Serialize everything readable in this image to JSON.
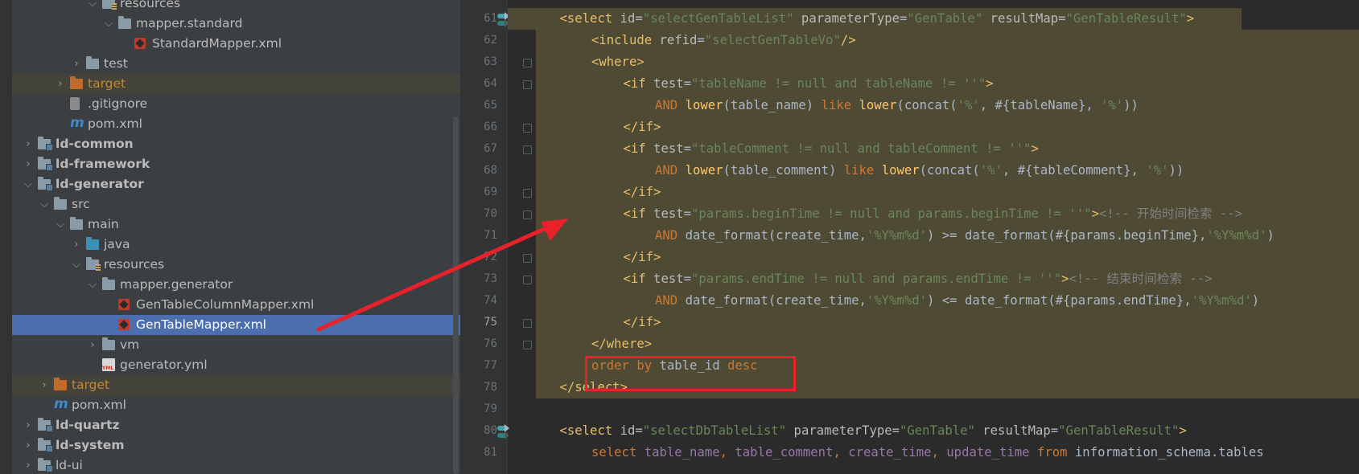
{
  "project_tree": {
    "rows": [
      {
        "label": "resources",
        "depth": 5,
        "icon": "resources-folder-icon",
        "expanded": true
      },
      {
        "label": "mapper.standard",
        "depth": 6,
        "icon": "folder-icon",
        "expanded": true
      },
      {
        "label": "StandardMapper.xml",
        "depth": 7,
        "icon": "xml-file-icon"
      },
      {
        "label": "test",
        "depth": 4,
        "icon": "folder-icon",
        "expanded": false
      },
      {
        "label": "target",
        "depth": 3,
        "icon": "excluded-folder-icon",
        "expanded": false,
        "style": "excluded"
      },
      {
        "label": ".gitignore",
        "depth": 3,
        "icon": "gitignore-file-icon"
      },
      {
        "label": "pom.xml",
        "depth": 3,
        "icon": "maven-file-icon"
      },
      {
        "label": "ld-common",
        "depth": 1,
        "icon": "module-folder-icon",
        "expanded": false,
        "bold": true
      },
      {
        "label": "ld-framework",
        "depth": 1,
        "icon": "module-folder-icon",
        "expanded": false,
        "bold": true
      },
      {
        "label": "ld-generator",
        "depth": 1,
        "icon": "module-folder-icon",
        "expanded": true,
        "bold": true
      },
      {
        "label": "src",
        "depth": 2,
        "icon": "folder-icon",
        "expanded": true
      },
      {
        "label": "main",
        "depth": 3,
        "icon": "folder-icon",
        "expanded": true
      },
      {
        "label": "java",
        "depth": 4,
        "icon": "source-folder-icon",
        "expanded": false
      },
      {
        "label": "resources",
        "depth": 4,
        "icon": "resources-folder-icon",
        "expanded": true
      },
      {
        "label": "mapper.generator",
        "depth": 5,
        "icon": "folder-icon",
        "expanded": true
      },
      {
        "label": "GenTableColumnMapper.xml",
        "depth": 6,
        "icon": "xml-file-icon"
      },
      {
        "label": "GenTableMapper.xml",
        "depth": 6,
        "icon": "xml-file-icon",
        "selected": true
      },
      {
        "label": "vm",
        "depth": 5,
        "icon": "folder-icon",
        "expanded": false
      },
      {
        "label": "generator.yml",
        "depth": 5,
        "icon": "yml-file-icon"
      },
      {
        "label": "target",
        "depth": 2,
        "icon": "excluded-folder-icon",
        "expanded": false,
        "style": "excluded"
      },
      {
        "label": "pom.xml",
        "depth": 2,
        "icon": "maven-file-icon"
      },
      {
        "label": "ld-quartz",
        "depth": 1,
        "icon": "module-folder-icon",
        "expanded": false,
        "bold": true
      },
      {
        "label": "ld-system",
        "depth": 1,
        "icon": "module-folder-icon",
        "expanded": false,
        "bold": true
      },
      {
        "label": "ld-ui",
        "depth": 1,
        "icon": "module-folder-icon",
        "expanded": false
      }
    ]
  },
  "editor": {
    "current_line": "75",
    "lines": [
      {
        "no": "61",
        "tokens": [
          {
            "t": "<select ",
            "c": "tag"
          },
          {
            "t": "id",
            "c": "attr"
          },
          {
            "t": "=",
            "c": "id"
          },
          {
            "t": "\"selectGenTableList\"",
            "c": "str"
          },
          {
            "t": " parameterType",
            "c": "attr"
          },
          {
            "t": "=",
            "c": "id"
          },
          {
            "t": "\"GenTable\"",
            "c": "str"
          },
          {
            "t": " resultMap",
            "c": "attr"
          },
          {
            "t": "=",
            "c": "id"
          },
          {
            "t": "\"GenTableResult\"",
            "c": "str"
          },
          {
            "t": ">",
            "c": "tag"
          }
        ]
      },
      {
        "no": "62",
        "tokens": [
          {
            "t": "<include ",
            "c": "tag"
          },
          {
            "t": "refid",
            "c": "attr"
          },
          {
            "t": "=",
            "c": "id"
          },
          {
            "t": "\"selectGenTableVo\"",
            "c": "str"
          },
          {
            "t": "/>",
            "c": "tag"
          }
        ]
      },
      {
        "no": "63",
        "tokens": [
          {
            "t": "<where>",
            "c": "tag"
          }
        ]
      },
      {
        "no": "64",
        "tokens": [
          {
            "t": "<if ",
            "c": "tag"
          },
          {
            "t": "test",
            "c": "attr"
          },
          {
            "t": "=",
            "c": "id"
          },
          {
            "t": "\"tableName != null and tableName != ''\"",
            "c": "str"
          },
          {
            "t": ">",
            "c": "tag"
          }
        ]
      },
      {
        "no": "65",
        "tokens": [
          {
            "t": "AND ",
            "c": "kw"
          },
          {
            "t": "lower",
            "c": "fn"
          },
          {
            "t": "(table_name) ",
            "c": "id"
          },
          {
            "t": "like ",
            "c": "kw"
          },
          {
            "t": "lower",
            "c": "fn"
          },
          {
            "t": "(concat(",
            "c": "id"
          },
          {
            "t": "'%'",
            "c": "str"
          },
          {
            "t": ", #{tableName}, ",
            "c": "id"
          },
          {
            "t": "'%'",
            "c": "str"
          },
          {
            "t": "))",
            "c": "id"
          }
        ]
      },
      {
        "no": "66",
        "tokens": [
          {
            "t": "</if>",
            "c": "tag"
          }
        ]
      },
      {
        "no": "67",
        "tokens": [
          {
            "t": "<if ",
            "c": "tag"
          },
          {
            "t": "test",
            "c": "attr"
          },
          {
            "t": "=",
            "c": "id"
          },
          {
            "t": "\"tableComment != null and tableComment != ''\"",
            "c": "str"
          },
          {
            "t": ">",
            "c": "tag"
          }
        ]
      },
      {
        "no": "68",
        "tokens": [
          {
            "t": "AND ",
            "c": "kw"
          },
          {
            "t": "lower",
            "c": "fn"
          },
          {
            "t": "(table_comment) ",
            "c": "id"
          },
          {
            "t": "like ",
            "c": "kw"
          },
          {
            "t": "lower",
            "c": "fn"
          },
          {
            "t": "(concat(",
            "c": "id"
          },
          {
            "t": "'%'",
            "c": "str"
          },
          {
            "t": ", #{tableComment}, ",
            "c": "id"
          },
          {
            "t": "'%'",
            "c": "str"
          },
          {
            "t": "))",
            "c": "id"
          }
        ]
      },
      {
        "no": "69",
        "tokens": [
          {
            "t": "</if>",
            "c": "tag"
          }
        ]
      },
      {
        "no": "70",
        "tokens": [
          {
            "t": "<if ",
            "c": "tag"
          },
          {
            "t": "test",
            "c": "attr"
          },
          {
            "t": "=",
            "c": "id"
          },
          {
            "t": "\"params.beginTime != null and params.beginTime != ''\"",
            "c": "str"
          },
          {
            "t": ">",
            "c": "tag"
          },
          {
            "t": "<!-- 开始时间检索 -->",
            "c": "cm"
          }
        ]
      },
      {
        "no": "71",
        "tokens": [
          {
            "t": "AND ",
            "c": "kw"
          },
          {
            "t": "date_format(create_time,",
            "c": "id"
          },
          {
            "t": "'%Y%m%d'",
            "c": "str"
          },
          {
            "t": ") ",
            "c": "id"
          },
          {
            "t": ">",
            "c": "id"
          },
          {
            "t": "= date_format(#{params.beginTime},",
            "c": "id"
          },
          {
            "t": "'%Y%m%d'",
            "c": "str"
          },
          {
            "t": ")",
            "c": "id"
          }
        ]
      },
      {
        "no": "72",
        "tokens": [
          {
            "t": "</if>",
            "c": "tag"
          }
        ]
      },
      {
        "no": "73",
        "tokens": [
          {
            "t": "<if",
            "c": "tag"
          },
          {
            "t": " test",
            "c": "attr"
          },
          {
            "t": "=",
            "c": "id"
          },
          {
            "t": "\"params.endTime != null and params.endTime != ''\"",
            "c": "str"
          },
          {
            "t": ">",
            "c": "tag"
          },
          {
            "t": "<!-- 结束时间检索 -->",
            "c": "cm"
          }
        ]
      },
      {
        "no": "74",
        "tokens": [
          {
            "t": "AND ",
            "c": "kw"
          },
          {
            "t": "date_format(create_time,",
            "c": "id"
          },
          {
            "t": "'%Y%m%d'",
            "c": "str"
          },
          {
            "t": ") ",
            "c": "id"
          },
          {
            "t": "<",
            "c": "id"
          },
          {
            "t": "= date_format(#{params.endTime},",
            "c": "id"
          },
          {
            "t": "'%Y%m%d'",
            "c": "str"
          },
          {
            "t": ")",
            "c": "id"
          }
        ]
      },
      {
        "no": "75",
        "tokens": [
          {
            "t": "</if>",
            "c": "tag"
          }
        ]
      },
      {
        "no": "76",
        "tokens": [
          {
            "t": "</where>",
            "c": "tag"
          }
        ]
      },
      {
        "no": "77",
        "tokens": [
          {
            "t": "order by ",
            "c": "kw"
          },
          {
            "t": "table_id ",
            "c": "id"
          },
          {
            "t": "desc",
            "c": "kw"
          }
        ]
      },
      {
        "no": "78",
        "tokens": [
          {
            "t": "</select>",
            "c": "tag"
          }
        ]
      },
      {
        "no": "79",
        "tokens": []
      },
      {
        "no": "80",
        "tokens": [
          {
            "t": "<select ",
            "c": "tag"
          },
          {
            "t": "id",
            "c": "attr"
          },
          {
            "t": "=",
            "c": "id"
          },
          {
            "t": "\"selectDbTableList\"",
            "c": "str"
          },
          {
            "t": " parameterType",
            "c": "attr"
          },
          {
            "t": "=",
            "c": "id"
          },
          {
            "t": "\"GenTable\"",
            "c": "str"
          },
          {
            "t": " resultMap",
            "c": "attr"
          },
          {
            "t": "=",
            "c": "id"
          },
          {
            "t": "\"GenTableResult\"",
            "c": "str"
          },
          {
            "t": ">",
            "c": "tag"
          }
        ]
      },
      {
        "no": "81",
        "tokens": [
          {
            "t": "select ",
            "c": "kw"
          },
          {
            "t": "table_name",
            "c": "col"
          },
          {
            "t": ", ",
            "c": "kw"
          },
          {
            "t": "table_comment",
            "c": "col"
          },
          {
            "t": ", ",
            "c": "kw"
          },
          {
            "t": "create_time",
            "c": "col"
          },
          {
            "t": ", ",
            "c": "kw"
          },
          {
            "t": "update_time ",
            "c": "col"
          },
          {
            "t": "from ",
            "c": "kw"
          },
          {
            "t": "information_schema.tables",
            "c": "id"
          }
        ]
      }
    ]
  },
  "annotations": {
    "box_color": "#e8212b",
    "arrow_color": "#e8212b"
  }
}
